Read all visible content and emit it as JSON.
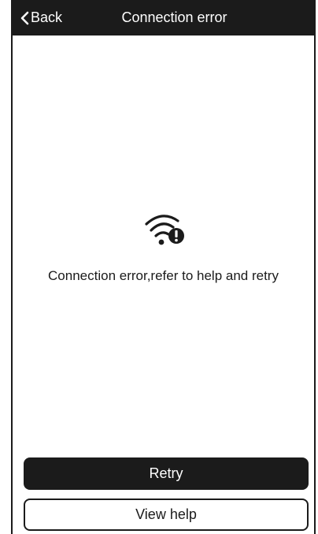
{
  "header": {
    "back_label": "Back",
    "title": "Connection error",
    "back_icon": "chevron-left-icon"
  },
  "main": {
    "icon": "wifi-error-icon",
    "message": "Connection error,refer to help and retry"
  },
  "actions": {
    "retry_label": "Retry",
    "help_label": "View help"
  },
  "colors": {
    "header_bg": "#1b1b1b",
    "primary_button_bg": "#1b1b1b",
    "text": "#1b1b1b",
    "background": "#ffffff"
  }
}
